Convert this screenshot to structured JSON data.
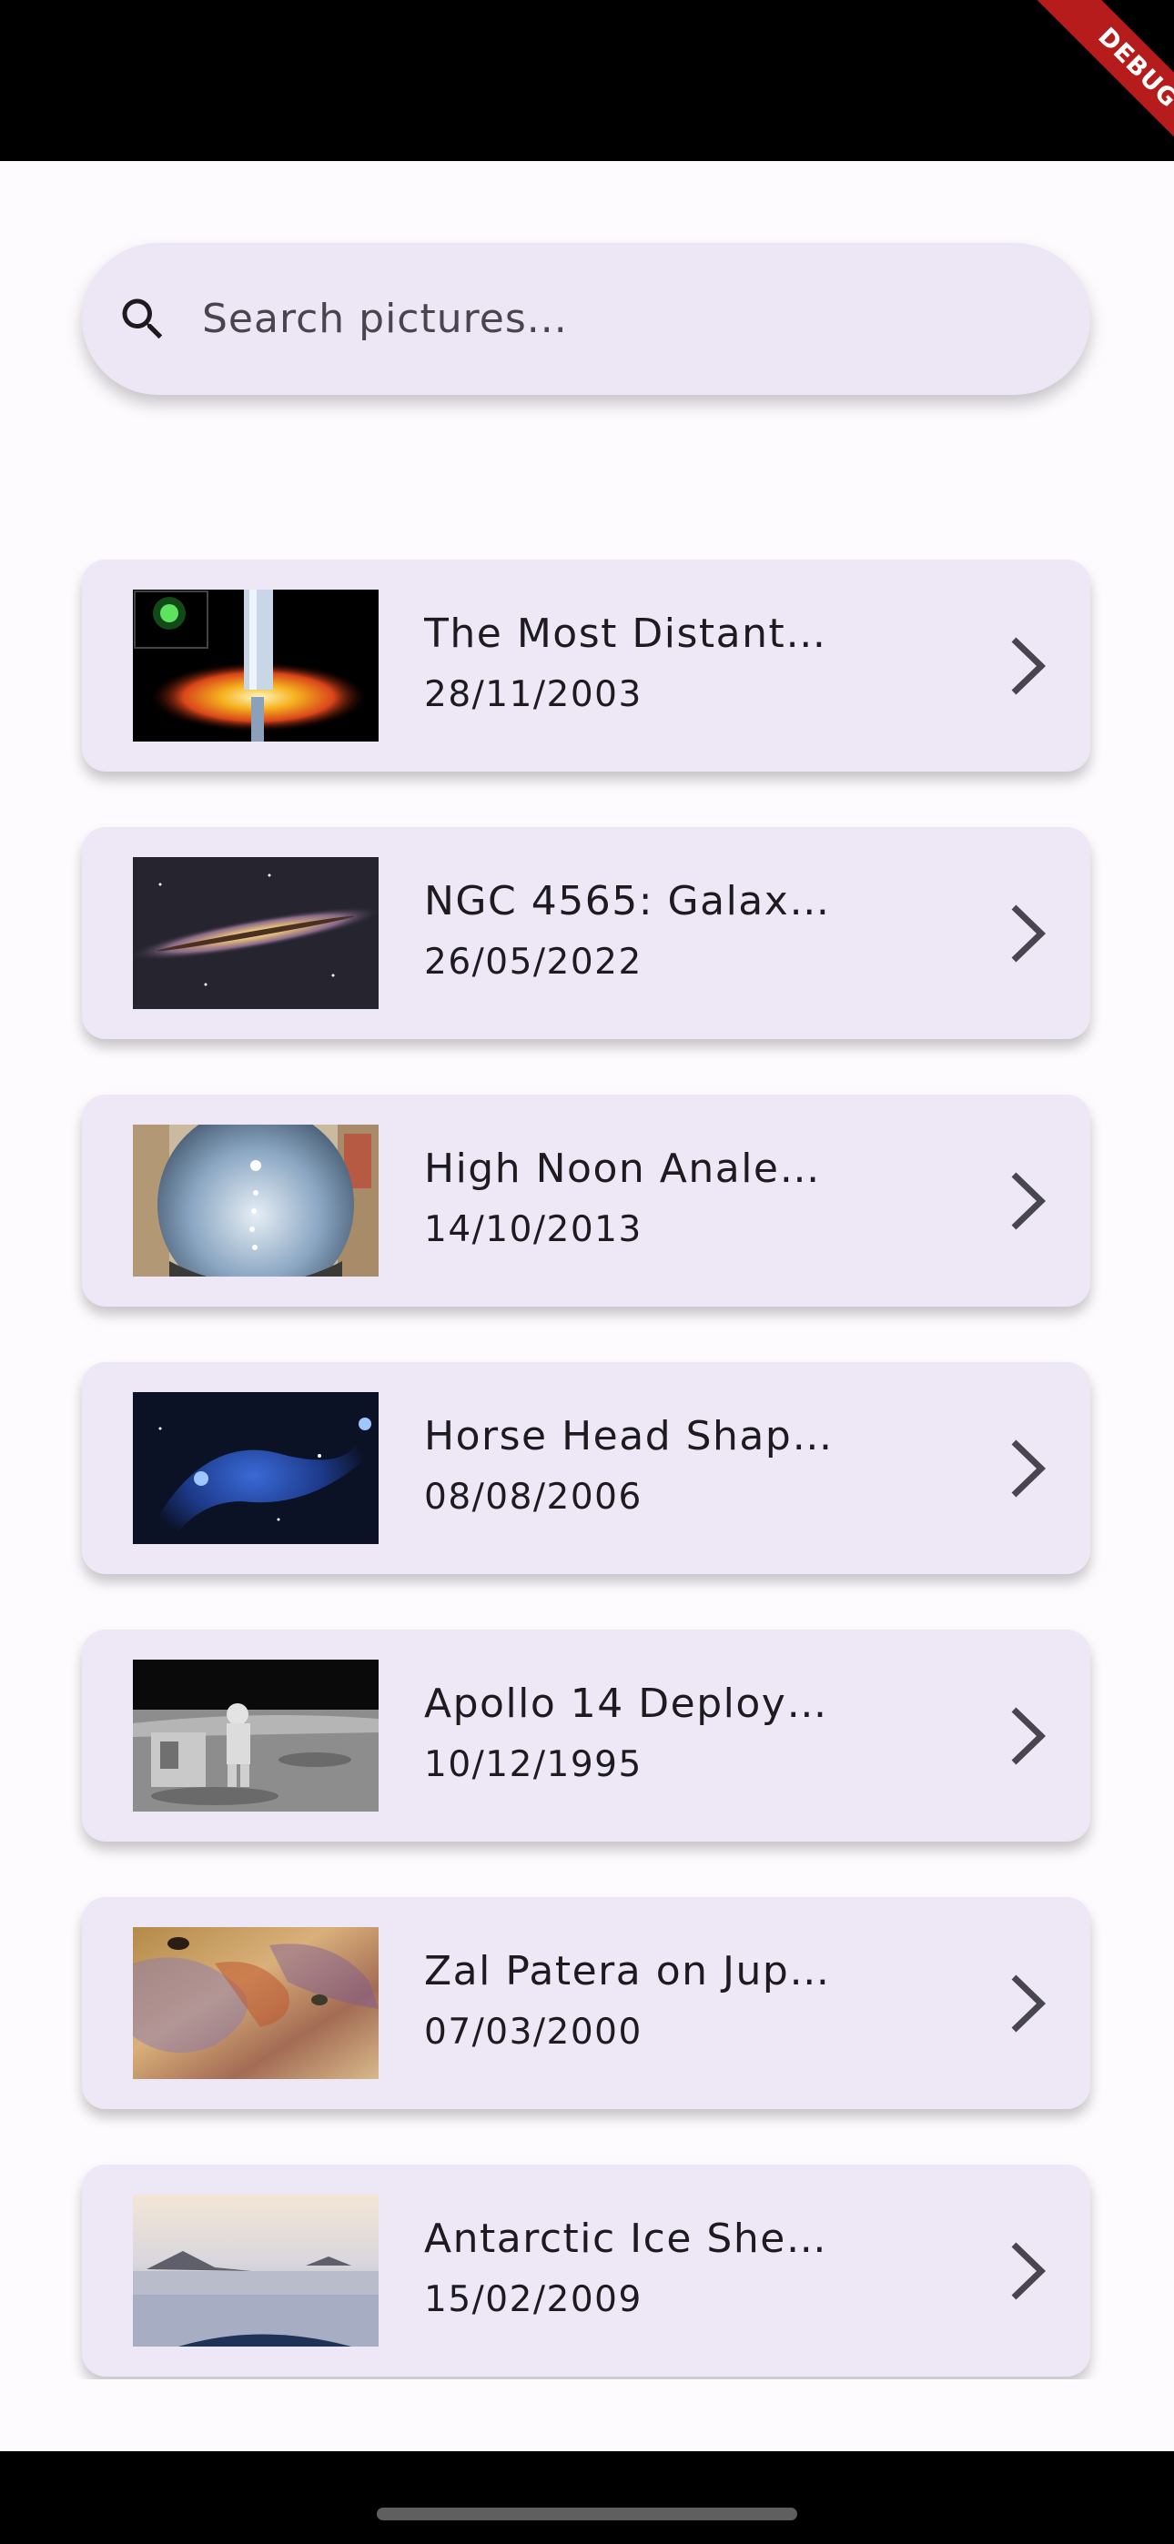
{
  "status_bar": {
    "debug_label": "DEBUG"
  },
  "search": {
    "placeholder": "Search pictures..."
  },
  "pictures": [
    {
      "title": "The Most Distant…",
      "date": "28/11/2003",
      "thumbnail": "black-hole-jet"
    },
    {
      "title": "NGC 4565: Galax…",
      "date": "26/05/2022",
      "thumbnail": "edge-on-galaxy"
    },
    {
      "title": "High Noon Anale…",
      "date": "14/10/2013",
      "thumbnail": "fisheye-sky-analemma"
    },
    {
      "title": "Horse Head Shap…",
      "date": "08/08/2006",
      "thumbnail": "blue-nebula"
    },
    {
      "title": "Apollo 14 Deploy…",
      "date": "10/12/1995",
      "thumbnail": "lunar-astronaut"
    },
    {
      "title": "Zal Patera on Jup…",
      "date": "07/03/2000",
      "thumbnail": "io-surface"
    },
    {
      "title": "Antarctic Ice She…",
      "date": "15/02/2009",
      "thumbnail": "antarctic-ice"
    }
  ],
  "colors": {
    "background": "#fefbff",
    "card": "#ede7f6",
    "search_bar": "#ece6f5",
    "text": "#1d1b20",
    "debug_banner": "#b71c1c"
  }
}
